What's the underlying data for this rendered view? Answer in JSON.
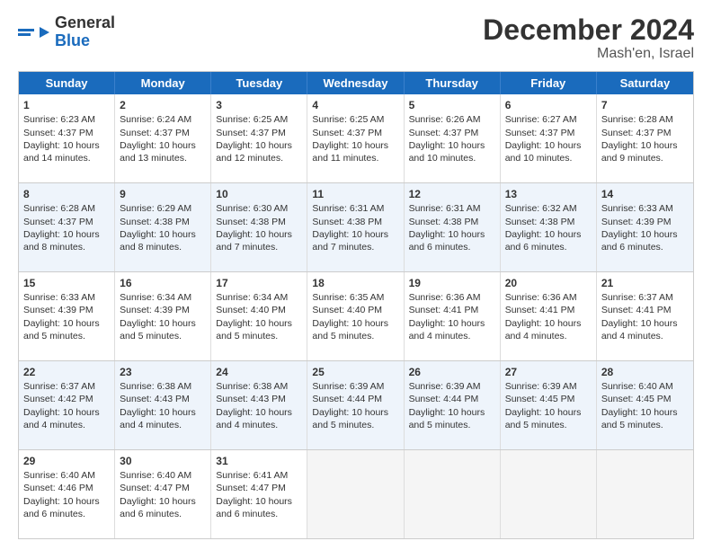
{
  "header": {
    "logo_line1": "General",
    "logo_line2": "Blue",
    "title": "December 2024",
    "subtitle": "Mash'en, Israel"
  },
  "days_of_week": [
    "Sunday",
    "Monday",
    "Tuesday",
    "Wednesday",
    "Thursday",
    "Friday",
    "Saturday"
  ],
  "weeks": [
    [
      {
        "day": "1",
        "sunrise": "Sunrise: 6:23 AM",
        "sunset": "Sunset: 4:37 PM",
        "daylight": "Daylight: 10 hours and 14 minutes."
      },
      {
        "day": "2",
        "sunrise": "Sunrise: 6:24 AM",
        "sunset": "Sunset: 4:37 PM",
        "daylight": "Daylight: 10 hours and 13 minutes."
      },
      {
        "day": "3",
        "sunrise": "Sunrise: 6:25 AM",
        "sunset": "Sunset: 4:37 PM",
        "daylight": "Daylight: 10 hours and 12 minutes."
      },
      {
        "day": "4",
        "sunrise": "Sunrise: 6:25 AM",
        "sunset": "Sunset: 4:37 PM",
        "daylight": "Daylight: 10 hours and 11 minutes."
      },
      {
        "day": "5",
        "sunrise": "Sunrise: 6:26 AM",
        "sunset": "Sunset: 4:37 PM",
        "daylight": "Daylight: 10 hours and 10 minutes."
      },
      {
        "day": "6",
        "sunrise": "Sunrise: 6:27 AM",
        "sunset": "Sunset: 4:37 PM",
        "daylight": "Daylight: 10 hours and 10 minutes."
      },
      {
        "day": "7",
        "sunrise": "Sunrise: 6:28 AM",
        "sunset": "Sunset: 4:37 PM",
        "daylight": "Daylight: 10 hours and 9 minutes."
      }
    ],
    [
      {
        "day": "8",
        "sunrise": "Sunrise: 6:28 AM",
        "sunset": "Sunset: 4:37 PM",
        "daylight": "Daylight: 10 hours and 8 minutes."
      },
      {
        "day": "9",
        "sunrise": "Sunrise: 6:29 AM",
        "sunset": "Sunset: 4:38 PM",
        "daylight": "Daylight: 10 hours and 8 minutes."
      },
      {
        "day": "10",
        "sunrise": "Sunrise: 6:30 AM",
        "sunset": "Sunset: 4:38 PM",
        "daylight": "Daylight: 10 hours and 7 minutes."
      },
      {
        "day": "11",
        "sunrise": "Sunrise: 6:31 AM",
        "sunset": "Sunset: 4:38 PM",
        "daylight": "Daylight: 10 hours and 7 minutes."
      },
      {
        "day": "12",
        "sunrise": "Sunrise: 6:31 AM",
        "sunset": "Sunset: 4:38 PM",
        "daylight": "Daylight: 10 hours and 6 minutes."
      },
      {
        "day": "13",
        "sunrise": "Sunrise: 6:32 AM",
        "sunset": "Sunset: 4:38 PM",
        "daylight": "Daylight: 10 hours and 6 minutes."
      },
      {
        "day": "14",
        "sunrise": "Sunrise: 6:33 AM",
        "sunset": "Sunset: 4:39 PM",
        "daylight": "Daylight: 10 hours and 6 minutes."
      }
    ],
    [
      {
        "day": "15",
        "sunrise": "Sunrise: 6:33 AM",
        "sunset": "Sunset: 4:39 PM",
        "daylight": "Daylight: 10 hours and 5 minutes."
      },
      {
        "day": "16",
        "sunrise": "Sunrise: 6:34 AM",
        "sunset": "Sunset: 4:39 PM",
        "daylight": "Daylight: 10 hours and 5 minutes."
      },
      {
        "day": "17",
        "sunrise": "Sunrise: 6:34 AM",
        "sunset": "Sunset: 4:40 PM",
        "daylight": "Daylight: 10 hours and 5 minutes."
      },
      {
        "day": "18",
        "sunrise": "Sunrise: 6:35 AM",
        "sunset": "Sunset: 4:40 PM",
        "daylight": "Daylight: 10 hours and 5 minutes."
      },
      {
        "day": "19",
        "sunrise": "Sunrise: 6:36 AM",
        "sunset": "Sunset: 4:41 PM",
        "daylight": "Daylight: 10 hours and 4 minutes."
      },
      {
        "day": "20",
        "sunrise": "Sunrise: 6:36 AM",
        "sunset": "Sunset: 4:41 PM",
        "daylight": "Daylight: 10 hours and 4 minutes."
      },
      {
        "day": "21",
        "sunrise": "Sunrise: 6:37 AM",
        "sunset": "Sunset: 4:41 PM",
        "daylight": "Daylight: 10 hours and 4 minutes."
      }
    ],
    [
      {
        "day": "22",
        "sunrise": "Sunrise: 6:37 AM",
        "sunset": "Sunset: 4:42 PM",
        "daylight": "Daylight: 10 hours and 4 minutes."
      },
      {
        "day": "23",
        "sunrise": "Sunrise: 6:38 AM",
        "sunset": "Sunset: 4:43 PM",
        "daylight": "Daylight: 10 hours and 4 minutes."
      },
      {
        "day": "24",
        "sunrise": "Sunrise: 6:38 AM",
        "sunset": "Sunset: 4:43 PM",
        "daylight": "Daylight: 10 hours and 4 minutes."
      },
      {
        "day": "25",
        "sunrise": "Sunrise: 6:39 AM",
        "sunset": "Sunset: 4:44 PM",
        "daylight": "Daylight: 10 hours and 5 minutes."
      },
      {
        "day": "26",
        "sunrise": "Sunrise: 6:39 AM",
        "sunset": "Sunset: 4:44 PM",
        "daylight": "Daylight: 10 hours and 5 minutes."
      },
      {
        "day": "27",
        "sunrise": "Sunrise: 6:39 AM",
        "sunset": "Sunset: 4:45 PM",
        "daylight": "Daylight: 10 hours and 5 minutes."
      },
      {
        "day": "28",
        "sunrise": "Sunrise: 6:40 AM",
        "sunset": "Sunset: 4:45 PM",
        "daylight": "Daylight: 10 hours and 5 minutes."
      }
    ],
    [
      {
        "day": "29",
        "sunrise": "Sunrise: 6:40 AM",
        "sunset": "Sunset: 4:46 PM",
        "daylight": "Daylight: 10 hours and 6 minutes."
      },
      {
        "day": "30",
        "sunrise": "Sunrise: 6:40 AM",
        "sunset": "Sunset: 4:47 PM",
        "daylight": "Daylight: 10 hours and 6 minutes."
      },
      {
        "day": "31",
        "sunrise": "Sunrise: 6:41 AM",
        "sunset": "Sunset: 4:47 PM",
        "daylight": "Daylight: 10 hours and 6 minutes."
      },
      {
        "day": "",
        "sunrise": "",
        "sunset": "",
        "daylight": ""
      },
      {
        "day": "",
        "sunrise": "",
        "sunset": "",
        "daylight": ""
      },
      {
        "day": "",
        "sunrise": "",
        "sunset": "",
        "daylight": ""
      },
      {
        "day": "",
        "sunrise": "",
        "sunset": "",
        "daylight": ""
      }
    ]
  ]
}
